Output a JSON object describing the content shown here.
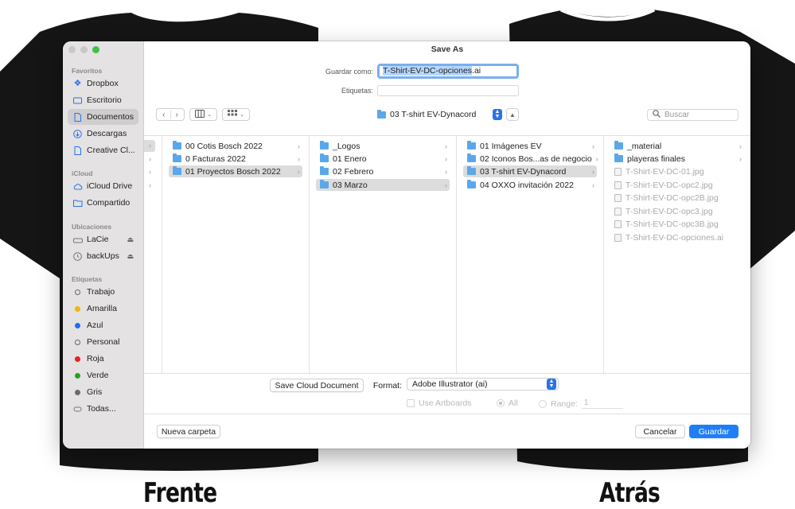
{
  "background": {
    "front_caption": "Frente",
    "back_caption": "Atrás"
  },
  "dialog": {
    "title": "Save As",
    "save_as_label": "Guardar como:",
    "filename_selected": "T-Shirt-EV-DC-opciones",
    "filename_ext": ".ai",
    "tags_label": "Etiquetas:",
    "current_folder": "03 T-shirt EV-Dynacord",
    "search_placeholder": "Buscar"
  },
  "sidebar": {
    "sections": [
      {
        "title": "Favoritos",
        "items": [
          {
            "label": "Dropbox",
            "icon": "dropbox-icon"
          },
          {
            "label": "Escritorio",
            "icon": "desktop-icon"
          },
          {
            "label": "Documentos",
            "icon": "document-icon",
            "selected": true
          },
          {
            "label": "Descargas",
            "icon": "download-icon"
          },
          {
            "label": "Creative Cl...",
            "icon": "file-icon"
          }
        ]
      },
      {
        "title": "iCloud",
        "items": [
          {
            "label": "iCloud Drive",
            "icon": "cloud-icon"
          },
          {
            "label": "Compartido",
            "icon": "shared-folder-icon"
          }
        ]
      },
      {
        "title": "Ubicaciones",
        "items": [
          {
            "label": "LaCie",
            "icon": "drive-icon",
            "eject": true
          },
          {
            "label": "backUps",
            "icon": "time-machine-icon",
            "eject": true
          }
        ]
      },
      {
        "title": "Etiquetas",
        "items": [
          {
            "label": "Trabajo",
            "color": "hollow"
          },
          {
            "label": "Amarilla",
            "color": "#f5b400"
          },
          {
            "label": "Azul",
            "color": "#1f6ff0"
          },
          {
            "label": "Personal",
            "color": "hollow"
          },
          {
            "label": "Roja",
            "color": "#e8231e"
          },
          {
            "label": "Verde",
            "color": "#23a41a"
          },
          {
            "label": "Gris",
            "color": "#6b6b6b"
          },
          {
            "label": "Todas...",
            "icon": "all-tags-icon"
          }
        ]
      }
    ]
  },
  "columns": [
    {
      "rows": [
        {
          "label": "00 Cotis Bosch 2022",
          "type": "folder"
        },
        {
          "label": "0 Facturas 2022",
          "type": "folder"
        },
        {
          "label": "01 Proyectos Bosch 2022",
          "type": "folder",
          "selected": true
        }
      ]
    },
    {
      "rows": [
        {
          "label": "_Logos",
          "type": "folder"
        },
        {
          "label": "01 Enero",
          "type": "folder"
        },
        {
          "label": "02 Febrero",
          "type": "folder"
        },
        {
          "label": "03 Marzo",
          "type": "folder",
          "selected": true
        }
      ]
    },
    {
      "rows": [
        {
          "label": "01 Imágenes EV",
          "type": "folder"
        },
        {
          "label": "02 Iconos Bos...as de negocio",
          "type": "folder"
        },
        {
          "label": "03 T-shirt EV-Dynacord",
          "type": "folder",
          "selected": true
        },
        {
          "label": "04 OXXO invitación 2022",
          "type": "folder"
        }
      ]
    },
    {
      "rows": [
        {
          "label": "_material",
          "type": "folder"
        },
        {
          "label": "playeras finales",
          "type": "folder"
        },
        {
          "label": "T-Shirt-EV-DC-01.jpg",
          "type": "file"
        },
        {
          "label": "T-Shirt-EV-DC-opc2.jpg",
          "type": "file"
        },
        {
          "label": "T-Shirt-EV-DC-opc2B.jpg",
          "type": "file"
        },
        {
          "label": "T-Shirt-EV-DC-opc3.jpg",
          "type": "file"
        },
        {
          "label": "T-Shirt-EV-DC-opc3B.jpg",
          "type": "file"
        },
        {
          "label": "T-Shirt-EV-DC-opciones.ai",
          "type": "file"
        }
      ]
    }
  ],
  "options": {
    "save_cloud_label": "Save Cloud Document",
    "format_label": "Format:",
    "format_value": "Adobe Illustrator (ai)",
    "use_artboards_label": "Use Artboards",
    "all_label": "All",
    "range_label": "Range:",
    "range_value": "1"
  },
  "footer": {
    "new_folder_label": "Nueva carpeta",
    "cancel_label": "Cancelar",
    "save_label": "Guardar"
  }
}
